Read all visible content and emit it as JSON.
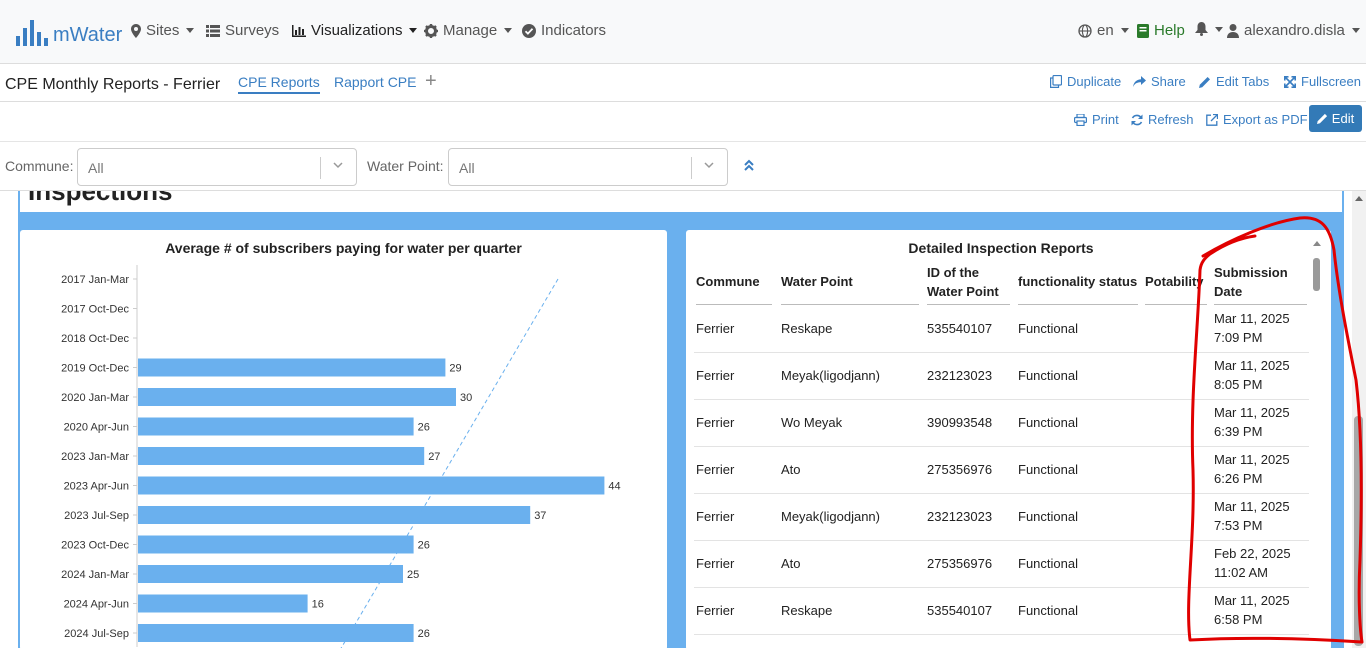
{
  "navbar": {
    "brand": "mWater",
    "items": [
      {
        "label": "Sites",
        "icon": "map-marker-icon",
        "caret": true
      },
      {
        "label": "Surveys",
        "icon": "list-icon",
        "caret": false
      },
      {
        "label": "Visualizations",
        "icon": "bar-chart-icon",
        "caret": true,
        "active": true
      },
      {
        "label": "Manage",
        "icon": "gear-icon",
        "caret": true
      },
      {
        "label": "Indicators",
        "icon": "check-circle-icon",
        "caret": false
      }
    ],
    "language": "en",
    "help": "Help",
    "user": "alexandro.disla"
  },
  "tabbar": {
    "title": "CPE Monthly Reports - Ferrier",
    "tabs": [
      {
        "label": "CPE Reports",
        "active": true
      },
      {
        "label": "Rapport CPE",
        "active": false
      }
    ],
    "add": "+",
    "actions": {
      "duplicate": "Duplicate",
      "share": "Share",
      "edit_tabs": "Edit Tabs",
      "fullscreen": "Fullscreen"
    }
  },
  "toolbar": {
    "print": "Print",
    "refresh": "Refresh",
    "export": "Export as PDF",
    "edit": "Edit"
  },
  "filters": {
    "commune_label": "Commune:",
    "commune_value": "All",
    "waterpoint_label": "Water Point:",
    "waterpoint_value": "All"
  },
  "section": {
    "heading": "Inspections"
  },
  "chart_data": {
    "type": "bar",
    "orientation": "horizontal",
    "title": "Average # of subscribers paying for water per quarter",
    "categories": [
      "2017 Jan-Mar",
      "2017 Oct-Dec",
      "2018 Oct-Dec",
      "2019 Oct-Dec",
      "2020 Jan-Mar",
      "2020 Apr-Jun",
      "2023 Jan-Mar",
      "2023 Apr-Jun",
      "2023 Jul-Sep",
      "2023 Oct-Dec",
      "2024 Jan-Mar",
      "2024 Apr-Jun",
      "2024 Jul-Sep"
    ],
    "values": [
      null,
      null,
      null,
      29,
      30,
      26,
      27,
      44,
      37,
      26,
      25,
      16,
      26
    ],
    "bar_color": "#6ab0ee",
    "trendline": "dashed",
    "xlim": [
      0,
      50
    ]
  },
  "table": {
    "title": "Detailed Inspection Reports",
    "columns": [
      "Commune",
      "Water Point",
      "ID of the Water Point",
      "functionality status",
      "Potability",
      "Submission Date"
    ],
    "rows": [
      [
        "Ferrier",
        "Reskape",
        "535540107",
        "Functional",
        "",
        "Mar 11, 2025 7:09 PM"
      ],
      [
        "Ferrier",
        "Meyak(ligodjann)",
        "232123023",
        "Functional",
        "",
        "Mar 11, 2025 8:05 PM"
      ],
      [
        "Ferrier",
        "Wo Meyak",
        "390993548",
        "Functional",
        "",
        "Mar 11, 2025 6:39 PM"
      ],
      [
        "Ferrier",
        "Ato",
        "275356976",
        "Functional",
        "",
        "Mar 11, 2025 6:26 PM"
      ],
      [
        "Ferrier",
        "Meyak(ligodjann)",
        "232123023",
        "Functional",
        "",
        "Mar 11, 2025 7:53 PM"
      ],
      [
        "Ferrier",
        "Ato",
        "275356976",
        "Functional",
        "",
        "Feb 22, 2025 11:02 AM"
      ],
      [
        "Ferrier",
        "Reskape",
        "535540107",
        "Functional",
        "",
        "Mar 11, 2025 6:58 PM"
      ]
    ]
  },
  "colors": {
    "accent": "#3a7ec2",
    "panel": "#6ab0ee",
    "annotation": "#e00000"
  }
}
